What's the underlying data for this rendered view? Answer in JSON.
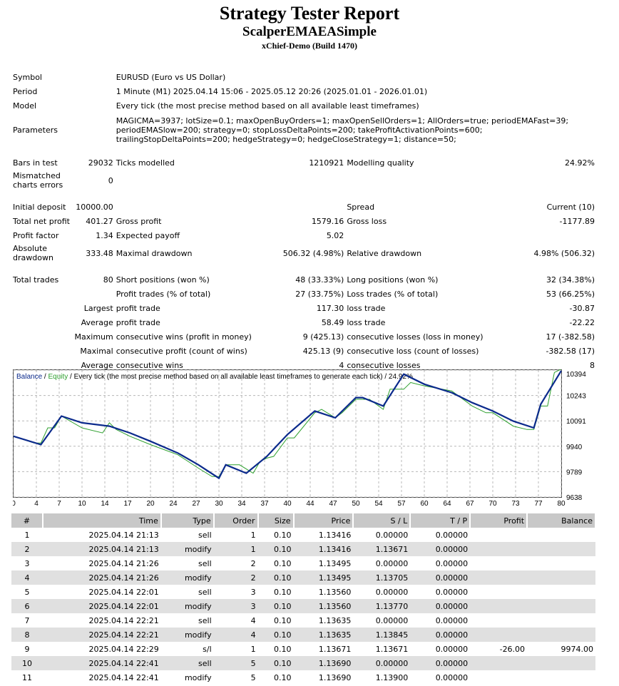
{
  "header": {
    "title": "Strategy Tester Report",
    "expert": "ScalperEMAEASimple",
    "server": "xChief-Demo (Build 1470)"
  },
  "summary": {
    "symbol_label": "Symbol",
    "symbol_value": "EURUSD (Euro vs US Dollar)",
    "period_label": "Period",
    "period_value": "1 Minute (M1) 2025.04.14 15:06 - 2025.05.12 20:26 (2025.01.01 - 2026.01.01)",
    "model_label": "Model",
    "model_value": "Every tick (the most precise method based on all available least timeframes)",
    "parameters_label": "Parameters",
    "parameters_value": "MAGICMA=3937; lotSize=0.1; maxOpenBuyOrders=1; maxOpenSellOrders=1; AllOrders=true; periodEMAFast=39; periodEMASlow=200; strategy=0; stopLossDeltaPoints=200; takeProfitActivationPoints=600; trailingStopDeltaPoints=200; hedgeStrategy=0; hedgeCloseStrategy=1; distance=50;",
    "bars_label": "Bars in test",
    "bars_value": "29032",
    "ticks_label": "Ticks modelled",
    "ticks_value": "1210921",
    "quality_label": "Modelling quality",
    "quality_value": "24.92%",
    "mismatch_label": "Mismatched charts errors",
    "mismatch_value": "0",
    "deposit_label": "Initial deposit",
    "deposit_value": "10000.00",
    "spread_label": "Spread",
    "spread_value": "Current (10)",
    "netprofit_label": "Total net profit",
    "netprofit_value": "401.27",
    "grossprofit_label": "Gross profit",
    "grossprofit_value": "1579.16",
    "grossloss_label": "Gross loss",
    "grossloss_value": "-1177.89",
    "pf_label": "Profit factor",
    "pf_value": "1.34",
    "payoff_label": "Expected payoff",
    "payoff_value": "5.02",
    "absdd_label": "Absolute drawdown",
    "absdd_value": "333.48",
    "maxdd_label": "Maximal drawdown",
    "maxdd_value": "506.32 (4.98%)",
    "reldd_label": "Relative drawdown",
    "reldd_value": "4.98% (506.32)",
    "trades_label": "Total trades",
    "trades_value": "80",
    "short_label": "Short positions (won %)",
    "short_value": "48 (33.33%)",
    "long_label": "Long positions (won %)",
    "long_value": "32 (34.38%)",
    "ptrades_label": "Profit trades (% of total)",
    "ptrades_value": "27 (33.75%)",
    "ltrades_label": "Loss trades (% of total)",
    "ltrades_value": "53 (66.25%)",
    "largest_label": "Largest",
    "largest_p_label": "profit trade",
    "largest_p_value": "117.30",
    "largest_l_label": "loss trade",
    "largest_l_value": "-30.87",
    "average_label": "Average",
    "average_p_label": "profit trade",
    "average_p_value": "58.49",
    "average_l_label": "loss trade",
    "average_l_value": "-22.22",
    "maximum_label": "Maximum",
    "maxwins_label": "consecutive wins (profit in money)",
    "maxwins_value": "9 (425.13)",
    "maxlosses_label": "consecutive losses (loss in money)",
    "maxlosses_value": "17 (-382.58)",
    "maximal_label": "Maximal",
    "maxprofit_label": "consecutive profit (count of wins)",
    "maxprofit_value": "425.13 (9)",
    "maxloss_label": "consecutive loss (count of losses)",
    "maxloss_value": "-382.58 (17)",
    "average2_label": "Average",
    "avgwins_label": "consecutive wins",
    "avgwins_value": "4",
    "avglosses_label": "consecutive losses",
    "avglosses_value": "8"
  },
  "chart_data": {
    "type": "line",
    "legend_balance": "Balance",
    "legend_sep1": " / ",
    "legend_equity": "Equity",
    "legend_rest": " / Every tick (the most precise method based on all available least timeframes to generate each tick) / 24.92%",
    "xticks": [
      "0",
      "4",
      "7",
      "10",
      "14",
      "17",
      "20",
      "24",
      "27",
      "30",
      "34",
      "37",
      "40",
      "44",
      "47",
      "50",
      "54",
      "57",
      "60",
      "64",
      "67",
      "70",
      "73",
      "77",
      "80"
    ],
    "yticks": [
      "10394",
      "10243",
      "10091",
      "9940",
      "9789",
      "9638"
    ],
    "ylim": [
      9638,
      10394
    ],
    "xlim": [
      0,
      80
    ],
    "grid": true,
    "colors": {
      "balance": "#0b2a8c",
      "equity": "#2ea02e"
    },
    "series": [
      {
        "name": "Balance",
        "x": [
          0,
          4,
          7,
          10,
          14,
          17,
          20,
          24,
          27,
          30,
          31,
          34,
          37,
          40,
          44,
          47,
          50,
          51,
          54,
          57,
          60,
          64,
          67,
          70,
          73,
          76,
          77,
          80
        ],
        "y": [
          10000,
          9950,
          10120,
          10080,
          10060,
          10020,
          9970,
          9900,
          9830,
          9750,
          9830,
          9780,
          9880,
          10010,
          10150,
          10110,
          10230,
          10230,
          10180,
          10370,
          10310,
          10260,
          10200,
          10150,
          10090,
          10050,
          10190,
          10390
        ]
      },
      {
        "name": "Equity",
        "x": [
          0,
          3,
          4,
          5,
          6,
          7,
          10,
          13,
          14,
          15,
          17,
          20,
          24,
          27,
          29,
          30,
          31,
          33,
          35,
          36,
          37,
          38,
          40,
          41,
          44,
          45,
          47,
          48,
          50,
          52,
          54,
          55,
          57,
          58,
          60,
          64,
          67,
          69,
          70,
          73,
          75,
          76,
          77,
          78,
          79,
          80
        ],
        "y": [
          10000,
          9960,
          9960,
          10050,
          10050,
          10120,
          10050,
          10020,
          10080,
          10040,
          10000,
          9950,
          9890,
          9810,
          9760,
          9760,
          9830,
          9830,
          9780,
          9850,
          9870,
          9880,
          9990,
          9990,
          10140,
          10160,
          10110,
          10140,
          10220,
          10220,
          10160,
          10280,
          10280,
          10320,
          10300,
          10270,
          10180,
          10140,
          10140,
          10060,
          10040,
          10040,
          10180,
          10180,
          10380,
          10400
        ]
      }
    ]
  },
  "deals": {
    "headers": [
      "#",
      "Time",
      "Type",
      "Order",
      "Size",
      "Price",
      "S / L",
      "T / P",
      "Profit",
      "Balance"
    ],
    "rows": [
      [
        "1",
        "2025.04.14 21:13",
        "sell",
        "1",
        "0.10",
        "1.13416",
        "0.00000",
        "0.00000",
        "",
        ""
      ],
      [
        "2",
        "2025.04.14 21:13",
        "modify",
        "1",
        "0.10",
        "1.13416",
        "1.13671",
        "0.00000",
        "",
        ""
      ],
      [
        "3",
        "2025.04.14 21:26",
        "sell",
        "2",
        "0.10",
        "1.13495",
        "0.00000",
        "0.00000",
        "",
        ""
      ],
      [
        "4",
        "2025.04.14 21:26",
        "modify",
        "2",
        "0.10",
        "1.13495",
        "1.13705",
        "0.00000",
        "",
        ""
      ],
      [
        "5",
        "2025.04.14 22:01",
        "sell",
        "3",
        "0.10",
        "1.13560",
        "0.00000",
        "0.00000",
        "",
        ""
      ],
      [
        "6",
        "2025.04.14 22:01",
        "modify",
        "3",
        "0.10",
        "1.13560",
        "1.13770",
        "0.00000",
        "",
        ""
      ],
      [
        "7",
        "2025.04.14 22:21",
        "sell",
        "4",
        "0.10",
        "1.13635",
        "0.00000",
        "0.00000",
        "",
        ""
      ],
      [
        "8",
        "2025.04.14 22:21",
        "modify",
        "4",
        "0.10",
        "1.13635",
        "1.13845",
        "0.00000",
        "",
        ""
      ],
      [
        "9",
        "2025.04.14 22:29",
        "s/l",
        "1",
        "0.10",
        "1.13671",
        "1.13671",
        "0.00000",
        "-26.00",
        "9974.00"
      ],
      [
        "10",
        "2025.04.14 22:41",
        "sell",
        "5",
        "0.10",
        "1.13690",
        "0.00000",
        "0.00000",
        "",
        ""
      ],
      [
        "11",
        "2025.04.14 22:41",
        "modify",
        "5",
        "0.10",
        "1.13690",
        "1.13900",
        "0.00000",
        "",
        ""
      ]
    ]
  }
}
